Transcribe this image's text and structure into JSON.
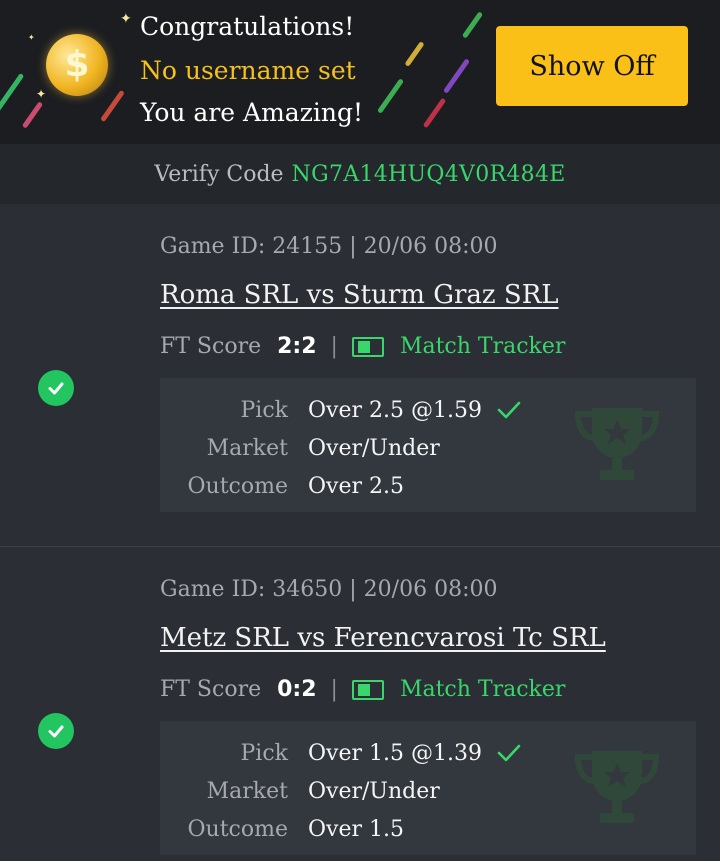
{
  "banner": {
    "congrats": "Congratulations!",
    "username": "No username set",
    "amazing": "You are Amazing!",
    "show_off": "Show Off"
  },
  "verify": {
    "label": "Verify Code",
    "code": "NG7A14HUQ4V0R484E"
  },
  "bets": [
    {
      "game_id": "Game ID: 24155 | 20/06 08:00",
      "match": "Roma SRL vs Sturm Graz SRL",
      "ft_label": "FT Score",
      "ft_score": "2:2",
      "separator": "|",
      "tracker": "Match Tracker",
      "pick_label": "Pick",
      "pick": "Over 2.5 @1.59",
      "market_label": "Market",
      "market": "Over/Under",
      "outcome_label": "Outcome",
      "outcome": "Over 2.5"
    },
    {
      "game_id": "Game ID: 34650 | 20/06 08:00",
      "match": "Metz SRL vs Ferencvarosi Tc SRL",
      "ft_label": "FT Score",
      "ft_score": "0:2",
      "separator": "|",
      "tracker": "Match Tracker",
      "pick_label": "Pick",
      "pick": "Over 1.5 @1.39",
      "market_label": "Market",
      "market": "Over/Under",
      "outcome_label": "Outcome",
      "outcome": "Over 1.5"
    }
  ],
  "icons": {
    "coin": "dollar-coin-icon",
    "status": "check-circle-icon",
    "tracker": "match-tracker-icon",
    "trophy": "trophy-icon",
    "tick": "checkmark-icon"
  },
  "colors": {
    "accent_green": "#39d66b",
    "gold": "#fbc017",
    "username_yellow": "#f5c11a"
  }
}
